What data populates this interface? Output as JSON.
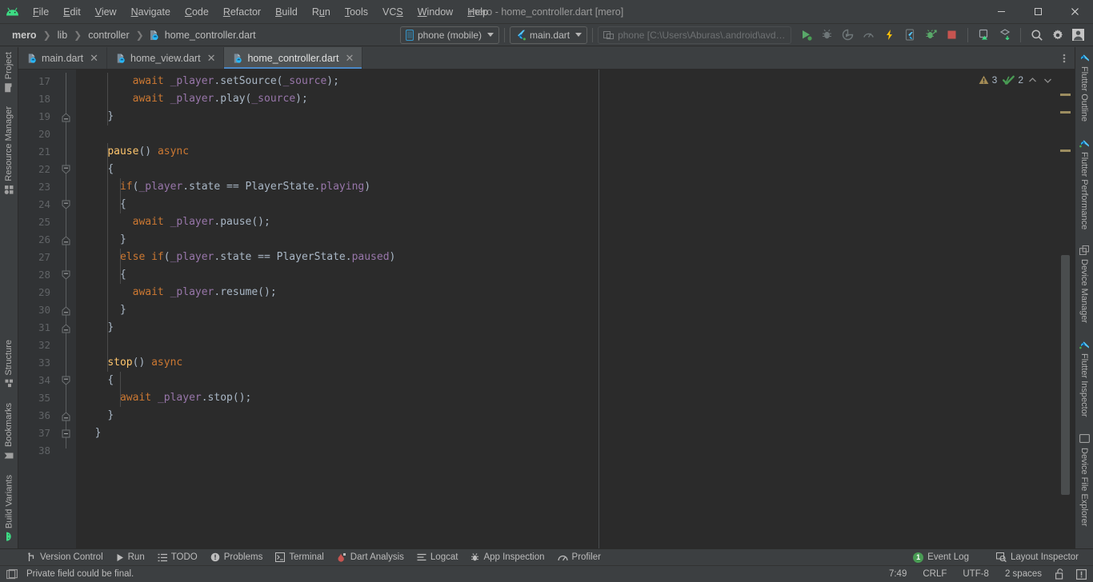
{
  "window": {
    "title": "mero - home_controller.dart [mero]",
    "menu": [
      "File",
      "Edit",
      "View",
      "Navigate",
      "Code",
      "Refactor",
      "Build",
      "Run",
      "Tools",
      "VCS",
      "Window",
      "Help"
    ],
    "minimize_label": "–",
    "maximize_label": "❐",
    "close_label": "✕"
  },
  "toolbar": {
    "breadcrumb": [
      "mero",
      "lib",
      "controller",
      "home_controller.dart"
    ],
    "device_selector": "phone (mobile)",
    "run_config": "main.dart",
    "device_field": "phone [C:\\Users\\Aburas\\.android\\avd\\...",
    "actions": [
      "run-icon",
      "debug-icon",
      "run-with-coverage-icon",
      "profile-icon",
      "hot-reload-icon",
      "open-devtools-icon",
      "flutter-attach-icon",
      "stop-icon",
      "device-manager-icon",
      "sdk-manager-icon",
      "search-everywhere-icon",
      "settings-icon",
      "account-icon"
    ]
  },
  "editor_tabs": [
    {
      "label": "main.dart",
      "active": false
    },
    {
      "label": "home_view.dart",
      "active": false
    },
    {
      "label": "home_controller.dart",
      "active": true
    }
  ],
  "inspections": {
    "warning_count": "3",
    "ok_count": "2",
    "prev_label": "⌃",
    "next_label": "⌄"
  },
  "editor": {
    "first_line": 17,
    "lines": [
      {
        "n": 17,
        "indent": 4,
        "tokens": [
          {
            "t": "await",
            "c": "t-kw"
          },
          {
            "t": " ",
            "c": "t-punc"
          },
          {
            "t": "_player",
            "c": "t-field"
          },
          {
            "t": ".setSource(",
            "c": "t-punc"
          },
          {
            "t": "_source",
            "c": "t-field"
          },
          {
            "t": ");",
            "c": "t-punc"
          }
        ]
      },
      {
        "n": 18,
        "indent": 4,
        "tokens": [
          {
            "t": "await",
            "c": "t-kw"
          },
          {
            "t": " ",
            "c": "t-punc"
          },
          {
            "t": "_player",
            "c": "t-field"
          },
          {
            "t": ".play(",
            "c": "t-punc"
          },
          {
            "t": "_source",
            "c": "t-field"
          },
          {
            "t": ");",
            "c": "t-punc"
          }
        ]
      },
      {
        "n": 19,
        "indent": 2,
        "tokens": [
          {
            "t": "}",
            "c": "t-brace"
          }
        ],
        "fold": "end"
      },
      {
        "n": 20,
        "indent": 0,
        "tokens": []
      },
      {
        "n": 21,
        "indent": 2,
        "tokens": [
          {
            "t": "pause",
            "c": "t-fn"
          },
          {
            "t": "() ",
            "c": "t-punc"
          },
          {
            "t": "async",
            "c": "t-kw"
          }
        ]
      },
      {
        "n": 22,
        "indent": 2,
        "tokens": [
          {
            "t": "{",
            "c": "t-brace"
          }
        ],
        "fold": "start"
      },
      {
        "n": 23,
        "indent": 3,
        "tokens": [
          {
            "t": "if",
            "c": "t-kw"
          },
          {
            "t": "(",
            "c": "t-punc"
          },
          {
            "t": "_player",
            "c": "t-field"
          },
          {
            "t": ".state == PlayerState.",
            "c": "t-punc"
          },
          {
            "t": "playing",
            "c": "t-field"
          },
          {
            "t": ")",
            "c": "t-punc"
          }
        ]
      },
      {
        "n": 24,
        "indent": 3,
        "tokens": [
          {
            "t": "{",
            "c": "t-brace"
          }
        ],
        "fold": "start"
      },
      {
        "n": 25,
        "indent": 4,
        "tokens": [
          {
            "t": "await",
            "c": "t-kw"
          },
          {
            "t": " ",
            "c": "t-punc"
          },
          {
            "t": "_player",
            "c": "t-field"
          },
          {
            "t": ".pause();",
            "c": "t-punc"
          }
        ]
      },
      {
        "n": 26,
        "indent": 3,
        "tokens": [
          {
            "t": "}",
            "c": "t-brace"
          }
        ],
        "fold": "end"
      },
      {
        "n": 27,
        "indent": 3,
        "tokens": [
          {
            "t": "else",
            "c": "t-kw"
          },
          {
            "t": " ",
            "c": "t-punc"
          },
          {
            "t": "if",
            "c": "t-kw"
          },
          {
            "t": "(",
            "c": "t-punc"
          },
          {
            "t": "_player",
            "c": "t-field"
          },
          {
            "t": ".state == PlayerState.",
            "c": "t-punc"
          },
          {
            "t": "paused",
            "c": "t-field"
          },
          {
            "t": ")",
            "c": "t-punc"
          }
        ]
      },
      {
        "n": 28,
        "indent": 3,
        "tokens": [
          {
            "t": "{",
            "c": "t-brace"
          }
        ],
        "fold": "start"
      },
      {
        "n": 29,
        "indent": 4,
        "tokens": [
          {
            "t": "await",
            "c": "t-kw"
          },
          {
            "t": " ",
            "c": "t-punc"
          },
          {
            "t": "_player",
            "c": "t-field"
          },
          {
            "t": ".resume();",
            "c": "t-punc"
          }
        ]
      },
      {
        "n": 30,
        "indent": 3,
        "tokens": [
          {
            "t": "}",
            "c": "t-brace"
          }
        ],
        "fold": "end"
      },
      {
        "n": 31,
        "indent": 2,
        "tokens": [
          {
            "t": "}",
            "c": "t-brace"
          }
        ],
        "fold": "end"
      },
      {
        "n": 32,
        "indent": 0,
        "tokens": []
      },
      {
        "n": 33,
        "indent": 2,
        "tokens": [
          {
            "t": "stop",
            "c": "t-fn"
          },
          {
            "t": "() ",
            "c": "t-punc"
          },
          {
            "t": "async",
            "c": "t-kw"
          }
        ]
      },
      {
        "n": 34,
        "indent": 2,
        "tokens": [
          {
            "t": "{",
            "c": "t-brace"
          }
        ],
        "fold": "start"
      },
      {
        "n": 35,
        "indent": 3,
        "tokens": [
          {
            "t": "await",
            "c": "t-kw"
          },
          {
            "t": " ",
            "c": "t-punc"
          },
          {
            "t": "_player",
            "c": "t-field"
          },
          {
            "t": ".stop();",
            "c": "t-punc"
          }
        ]
      },
      {
        "n": 36,
        "indent": 2,
        "tokens": [
          {
            "t": "}",
            "c": "t-brace"
          }
        ],
        "fold": "end"
      },
      {
        "n": 37,
        "indent": 1,
        "tokens": [
          {
            "t": "}",
            "c": "t-brace"
          }
        ],
        "fold": "endall"
      },
      {
        "n": 38,
        "indent": 0,
        "tokens": []
      }
    ]
  },
  "left_stripe": {
    "top": [
      {
        "label": "Project",
        "icon": "project-icon"
      },
      {
        "label": "Resource Manager",
        "icon": "resource-manager-icon"
      }
    ],
    "bottom": [
      {
        "label": "Structure",
        "icon": "structure-icon"
      },
      {
        "label": "Bookmarks",
        "icon": "bookmarks-icon"
      },
      {
        "label": "Build Variants",
        "icon": "build-variants-icon"
      }
    ]
  },
  "right_stripe": {
    "items": [
      {
        "label": "Flutter Outline",
        "icon": "flutter-icon"
      },
      {
        "label": "Flutter Performance",
        "icon": "flutter-icon"
      },
      {
        "label": "Device Manager",
        "icon": "device-manager-icon"
      },
      {
        "label": "Flutter Inspector",
        "icon": "flutter-icon"
      },
      {
        "label": "Device File Explorer",
        "icon": "device-file-explorer-icon"
      }
    ]
  },
  "tool_windows": {
    "left": [
      {
        "label": "Version Control",
        "icon": "vcs-icon"
      },
      {
        "label": "Run",
        "icon": "run-icon"
      },
      {
        "label": "TODO",
        "icon": "todo-icon"
      },
      {
        "label": "Problems",
        "icon": "problems-icon"
      },
      {
        "label": "Terminal",
        "icon": "terminal-icon"
      },
      {
        "label": "Dart Analysis",
        "icon": "dart-analysis-icon"
      },
      {
        "label": "Logcat",
        "icon": "logcat-icon"
      },
      {
        "label": "App Inspection",
        "icon": "app-inspection-icon"
      },
      {
        "label": "Profiler",
        "icon": "profiler-icon"
      }
    ],
    "right": [
      {
        "label": "Event Log",
        "icon": "event-log-icon",
        "badge": "1"
      },
      {
        "label": "Layout Inspector",
        "icon": "layout-inspector-icon",
        "badge": ""
      }
    ]
  },
  "status_bar": {
    "message": "Private field could be final.",
    "caret_position": "7:49",
    "line_separator": "CRLF",
    "encoding": "UTF-8",
    "indent": "2 spaces",
    "lock_icon": "unlocked-icon",
    "notification_icon": "notifications-icon"
  },
  "colors": {
    "accent": "#4a88c7",
    "keyword": "#cc7832",
    "function": "#ffc66d",
    "field": "#9876aa",
    "text": "#a9b7c6",
    "editor_bg": "#2b2b2b",
    "chrome_bg": "#3c3f41",
    "gutter_bg": "#313335"
  }
}
